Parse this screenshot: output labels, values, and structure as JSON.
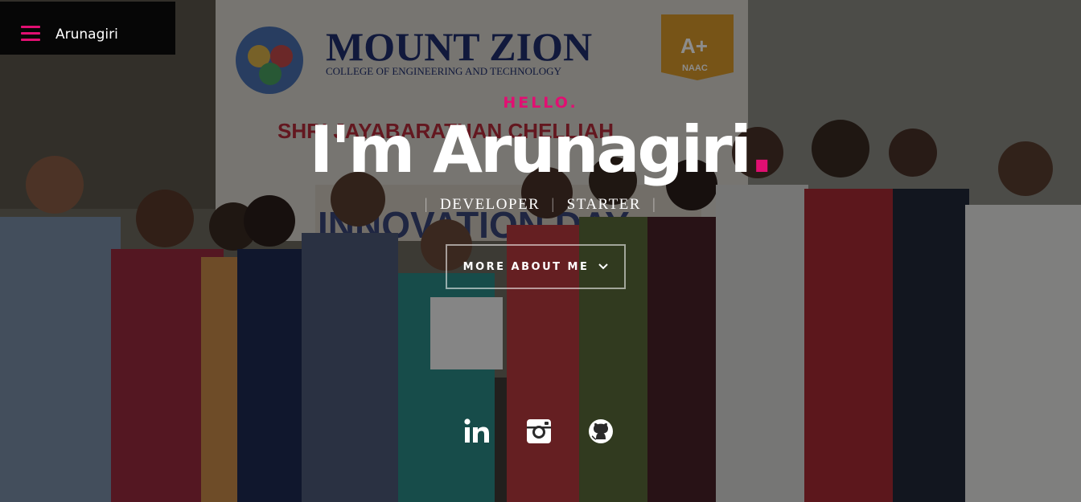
{
  "nav": {
    "brand": "Arunagiri",
    "menu_icon": "hamburger-menu-icon"
  },
  "hero": {
    "greeting": "HELLO.",
    "headline": "I'm Arunagiri",
    "headline_dot": ".",
    "roles": [
      "DEVELOPER",
      "STARTER"
    ],
    "cta_label": "MORE ABOUT ME",
    "cta_icon": "chevron-down-icon"
  },
  "social": [
    {
      "icon": "linkedin-icon"
    },
    {
      "icon": "instagram-icon"
    },
    {
      "icon": "github-icon"
    }
  ],
  "colors": {
    "accent": "#e10f72",
    "nav_bg": "#060606",
    "text": "#ffffff"
  },
  "background": {
    "banner_title": "MOUNT ZION",
    "banner_subtitle": "COLLEGE OF ENGINEERING AND TECHNOLOGY",
    "banner_line": "SHRI JAYABARATHAN CHELLIAH",
    "badge": "A+",
    "badge_caption": "NAAC"
  }
}
